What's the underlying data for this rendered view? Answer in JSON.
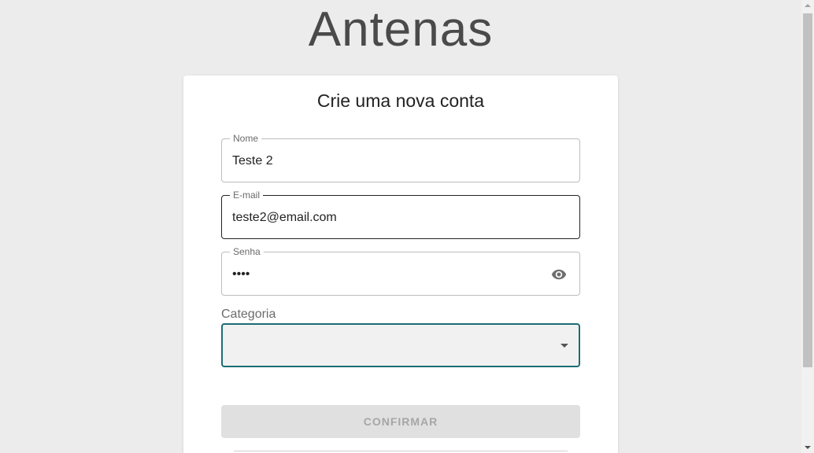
{
  "app": {
    "title": "Antenas"
  },
  "card": {
    "title": "Crie uma nova conta"
  },
  "form": {
    "name": {
      "label": "Nome",
      "value": "Teste 2"
    },
    "email": {
      "label": "E-mail",
      "value": "teste2@email.com"
    },
    "password": {
      "label": "Senha",
      "value": "••••",
      "toggle_icon": "eye-icon"
    },
    "category": {
      "label": "Categoria",
      "value": "",
      "dropdown_icon": "chevron-down-icon"
    },
    "confirm_label": "CONFIRMAR"
  },
  "colors": {
    "background": "#ececec",
    "card": "#ffffff",
    "select_focus_border": "#1b6e74",
    "disabled_button": "#e0e0e0",
    "disabled_text": "#a6a6a6"
  }
}
